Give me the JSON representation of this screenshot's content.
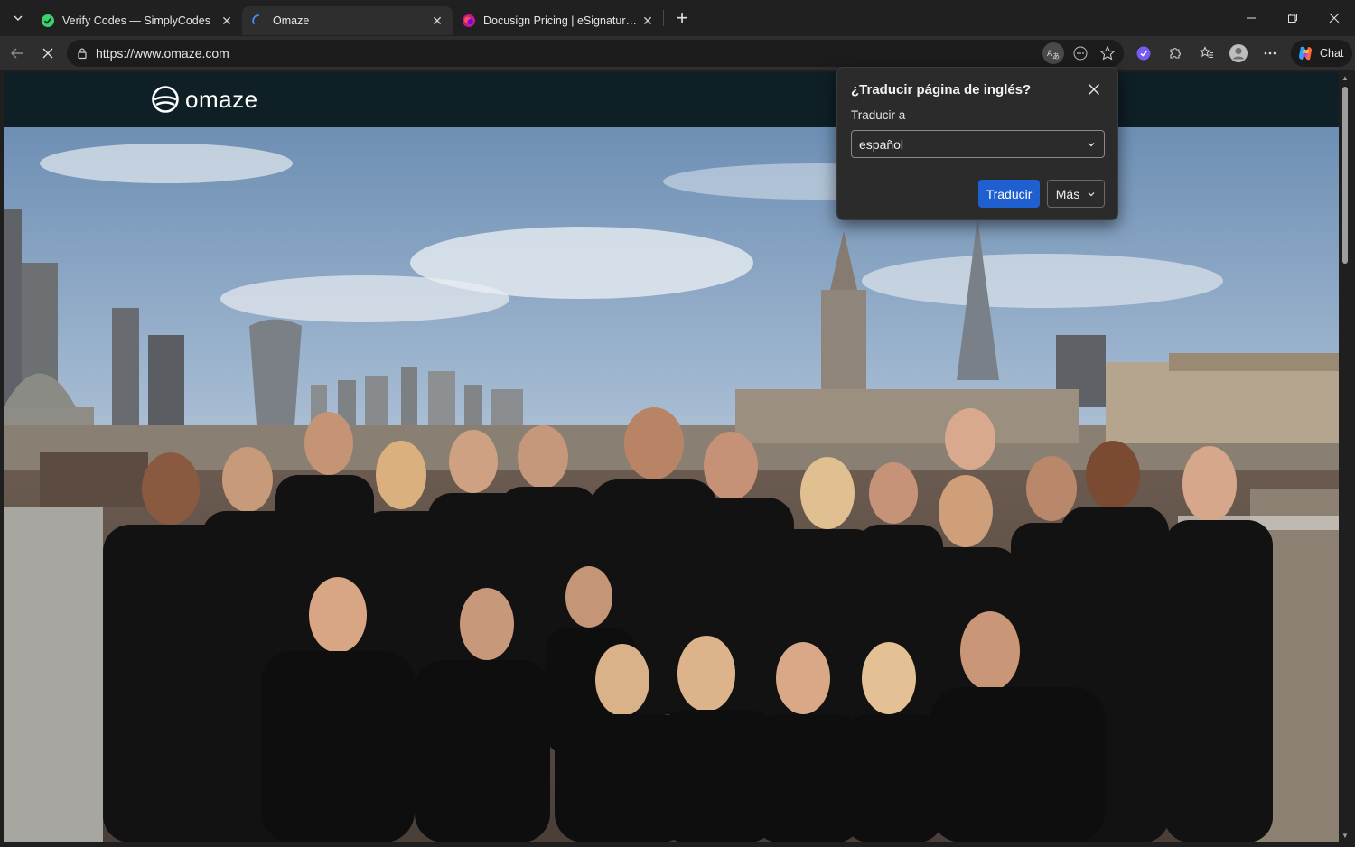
{
  "browser": {
    "tabs": [
      {
        "title": "Verify Codes — SimplyCodes",
        "favicon": "simplycodes-icon",
        "active": false
      },
      {
        "title": "Omaze",
        "favicon": "loading-spinner-icon",
        "active": true
      },
      {
        "title": "Docusign Pricing | eSignature Plans",
        "favicon": "docusign-icon",
        "active": false
      }
    ],
    "url": "https://www.omaze.com",
    "chat_label": "Chat"
  },
  "site": {
    "logo_text": "omaze"
  },
  "translate_popup": {
    "title": "¿Traducir página de inglés?",
    "label": "Traducir a",
    "selected_language": "español",
    "translate_button": "Traducir",
    "more_button": "Más"
  },
  "colors": {
    "site_header": "#0e1f26",
    "primary_button": "#1f5fd0",
    "popup_bg": "#2b2b2b"
  }
}
